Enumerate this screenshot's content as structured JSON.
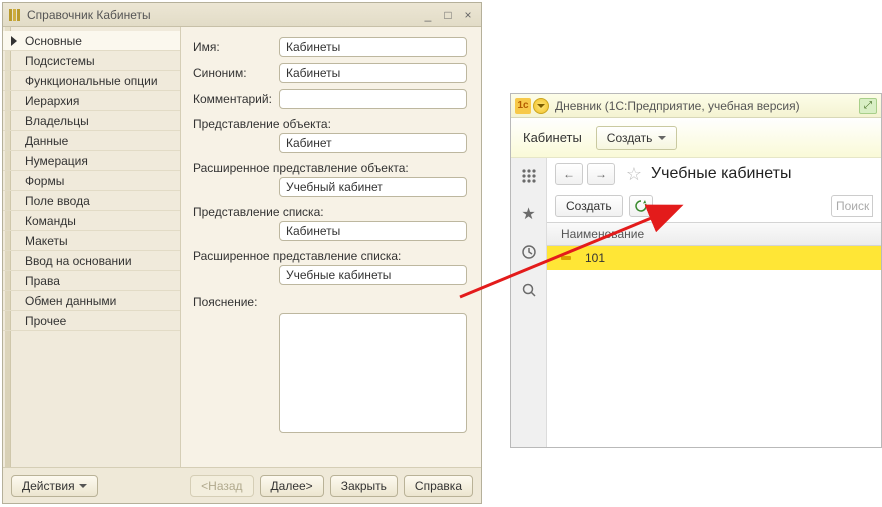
{
  "dlg": {
    "title": "Справочник Кабинеты",
    "tabs": [
      "Основные",
      "Подсистемы",
      "Функциональные опции",
      "Иерархия",
      "Владельцы",
      "Данные",
      "Нумерация",
      "Формы",
      "Поле ввода",
      "Команды",
      "Макеты",
      "Ввод на основании",
      "Права",
      "Обмен данными",
      "Прочее"
    ],
    "active_tab_index": 0,
    "fields": {
      "name_label": "Имя:",
      "name_value": "Кабинеты",
      "synonym_label": "Синоним:",
      "synonym_value": "Кабинеты",
      "comment_label": "Комментарий:",
      "comment_value": "",
      "obj_repr_label": "Представление объекта:",
      "obj_repr_value": "Кабинет",
      "obj_repr_ext_label": "Расширенное представление объекта:",
      "obj_repr_ext_value": "Учебный кабинет",
      "list_repr_label": "Представление списка:",
      "list_repr_value": "Кабинеты",
      "list_repr_ext_label": "Расширенное представление списка:",
      "list_repr_ext_value": "Учебные кабинеты",
      "explain_label": "Пояснение:"
    },
    "footer": {
      "actions": "Действия",
      "back": "<Назад",
      "next": "Далее>",
      "close": "Закрыть",
      "help": "Справка"
    }
  },
  "app": {
    "title": "Дневник  (1С:Предприятие, учебная версия)",
    "toolbar": {
      "cabinets_link": "Кабинеты",
      "create": "Создать"
    },
    "breadcrumb": "Учебные кабинеты",
    "list_toolbar": {
      "create": "Создать",
      "search_placeholder": "Поиск"
    },
    "grid": {
      "header_name": "Наименование",
      "rows": [
        {
          "name": "101"
        }
      ]
    }
  }
}
